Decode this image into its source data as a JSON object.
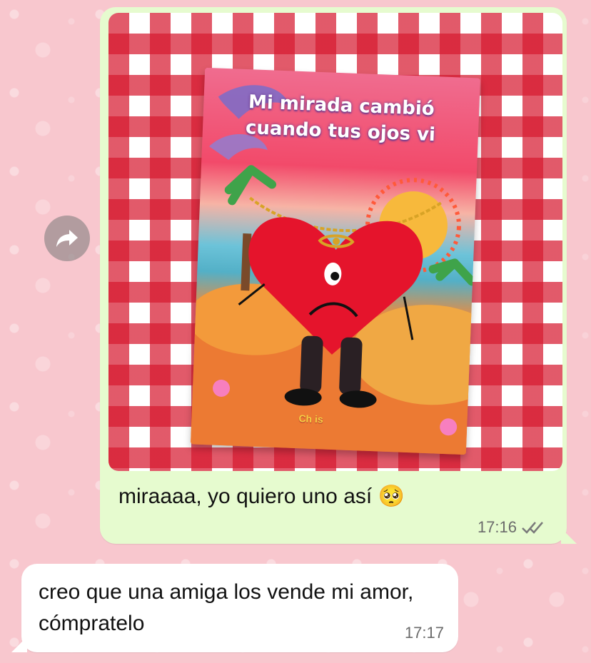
{
  "chat": {
    "sent_message": {
      "image": {
        "card_title_line1": "Mi mirada cambió",
        "card_title_line2": "cuando tus ojos vi",
        "card_brand": "Ch  is"
      },
      "text": "miraaaa, yo quiero uno así",
      "emoji": "🥺",
      "time": "17:16",
      "status": "read-double-check"
    },
    "received_message": {
      "text": "creo que una amiga los vende mi amor, cómpratelo",
      "time": "17:17"
    },
    "forward_icon": "forward-arrow-icon"
  },
  "colors": {
    "sent_bubble": "#e6fbcf",
    "received_bubble": "#ffffff",
    "wallpaper": "#f8c7ce",
    "check_read": "#7a7a7a"
  }
}
